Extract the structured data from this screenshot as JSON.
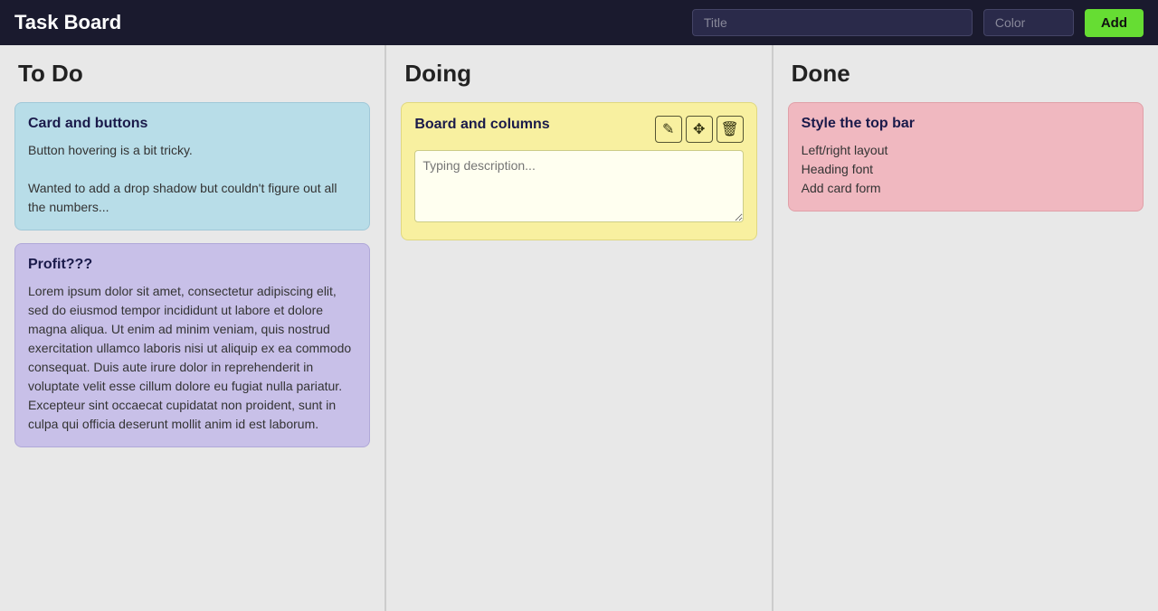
{
  "topbar": {
    "title": "Task Board",
    "title_input_placeholder": "Title",
    "color_input_placeholder": "Color",
    "add_button_label": "Add"
  },
  "columns": [
    {
      "id": "todo",
      "title": "To Do",
      "cards": [
        {
          "id": "card1",
          "title": "Card and buttons",
          "color": "blue",
          "body": "Button hovering is a bit tricky.\n\nWanted to add a drop shadow but couldn't figure out all the numbers..."
        },
        {
          "id": "card2",
          "title": "Profit???",
          "color": "purple",
          "body": "Lorem ipsum dolor sit amet, consectetur adipiscing elit, sed do eiusmod tempor incididunt ut labore et dolore magna aliqua. Ut enim ad minim veniam, quis nostrud exercitation ullamco laboris nisi ut aliquip ex ea commodo consequat. Duis aute irure dolor in reprehenderit in voluptate velit esse cillum dolore eu fugiat nulla pariatur. Excepteur sint occaecat cupidatat non proident, sunt in culpa qui officia deserunt mollit anim id est laborum."
        }
      ]
    },
    {
      "id": "doing",
      "title": "Doing",
      "cards": [
        {
          "id": "card3",
          "title": "Board and columns",
          "color": "yellow",
          "has_actions": true,
          "textarea_placeholder": "Typing description..."
        }
      ]
    },
    {
      "id": "done",
      "title": "Done",
      "cards": [
        {
          "id": "card4",
          "title": "Style the top bar",
          "color": "pink",
          "body": "Left/right layout\nHeading font\nAdd card form"
        }
      ]
    }
  ],
  "icons": {
    "edit": "✎",
    "move": "✥",
    "delete": "🗑"
  }
}
